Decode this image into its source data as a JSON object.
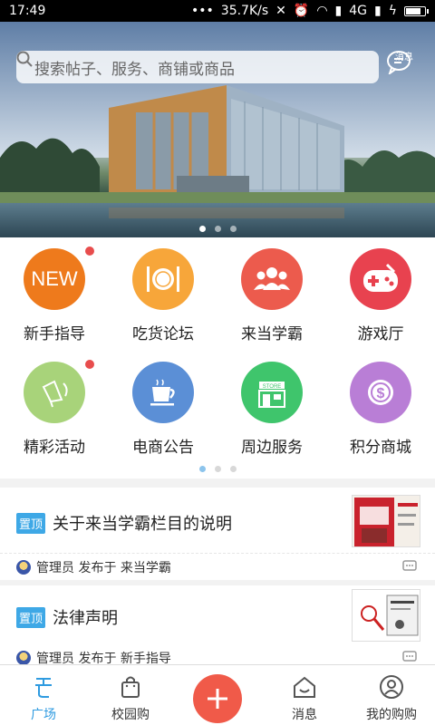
{
  "status_bar": {
    "time": "17:49",
    "speed": "35.7K/s",
    "network": "4G",
    "battery_level": 0.85
  },
  "search": {
    "placeholder": "搜索帖子、服务、商铺或商品"
  },
  "message_top": {
    "label": "消息"
  },
  "banner": {
    "slide_count": 3,
    "active_slide": 1
  },
  "grid": {
    "page_count": 3,
    "active_page": 1,
    "items": [
      {
        "label": "新手指导",
        "icon": "new-icon",
        "icon_text": "NEW",
        "color": "#ee7a1c",
        "has_badge": true
      },
      {
        "label": "吃货论坛",
        "icon": "dinner-plate-icon",
        "color": "#f7a63a",
        "has_badge": false
      },
      {
        "label": "来当学霸",
        "icon": "people-group-icon",
        "color": "#ec5b4d",
        "has_badge": false
      },
      {
        "label": "游戏厅",
        "icon": "gamepad-icon",
        "color": "#e8424f",
        "has_badge": false
      },
      {
        "label": "精彩活动",
        "icon": "megaphone-icon",
        "color": "#a8d37a",
        "has_badge": true
      },
      {
        "label": "电商公告",
        "icon": "coffee-cup-icon",
        "color": "#5b8fd6",
        "has_badge": false
      },
      {
        "label": "周边服务",
        "icon": "store-icon",
        "color": "#3fc56c",
        "has_badge": false
      },
      {
        "label": "积分商城",
        "icon": "coin-dollar-icon",
        "color": "#b97ed6",
        "has_badge": false
      }
    ]
  },
  "posts": [
    {
      "badge": "置顶",
      "title": "关于来当学霸栏目的说明",
      "author": "管理员",
      "published_in": "发布于",
      "board": "来当学霸"
    },
    {
      "badge": "置顶",
      "title": "法律声明",
      "author": "管理员",
      "published_in": "发布于",
      "board": "新手指导"
    }
  ],
  "tabbar": {
    "accent": "#2f9be0",
    "items": [
      {
        "label": "广场",
        "icon": "plaza-icon",
        "active": true
      },
      {
        "label": "校园购",
        "icon": "shopping-bag-icon",
        "active": false
      },
      {
        "label": "",
        "icon": "add-icon",
        "active": false
      },
      {
        "label": "消息",
        "icon": "message-house-icon",
        "active": false
      },
      {
        "label": "我的购购",
        "icon": "user-icon",
        "active": false
      }
    ]
  }
}
